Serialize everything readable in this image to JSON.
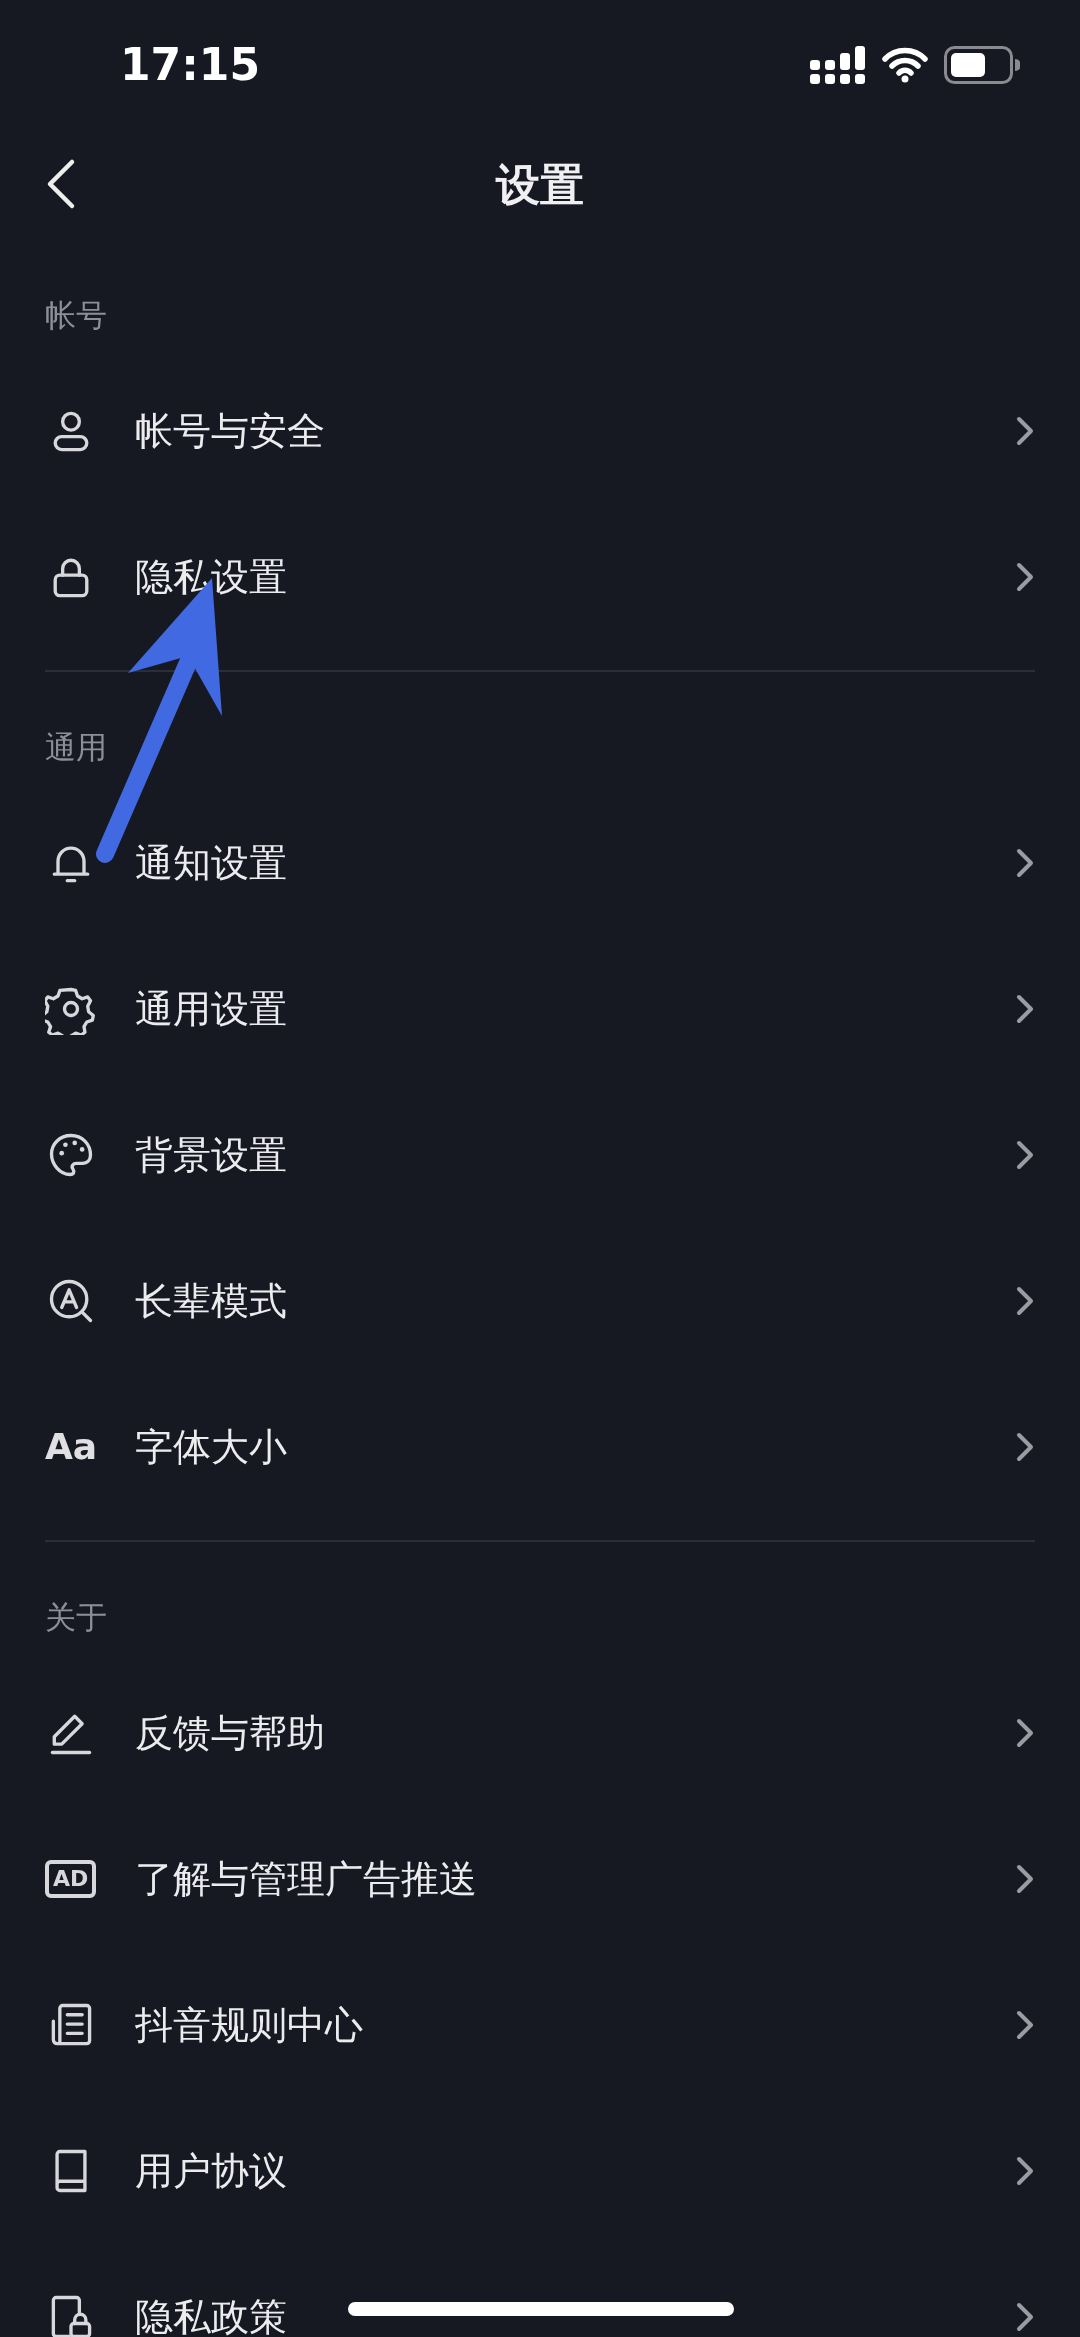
{
  "status_bar": {
    "time": "17:15"
  },
  "header": {
    "title": "设置"
  },
  "sections": [
    {
      "label": "帐号",
      "items": [
        {
          "label": "帐号与安全"
        },
        {
          "label": "隐私设置"
        }
      ]
    },
    {
      "label": "通用",
      "items": [
        {
          "label": "通知设置"
        },
        {
          "label": "通用设置"
        },
        {
          "label": "背景设置"
        },
        {
          "label": "长辈模式"
        },
        {
          "icon_text": "Aa",
          "label": "字体大小"
        }
      ]
    },
    {
      "label": "关于",
      "items": [
        {
          "label": "反馈与帮助"
        },
        {
          "icon_text": "AD",
          "label": "了解与管理广告推送"
        },
        {
          "label": "抖音规则中心"
        },
        {
          "label": "用户协议"
        },
        {
          "label": "隐私政策"
        }
      ]
    }
  ],
  "annotation": {
    "kind": "arrow",
    "color": "#4169e1"
  }
}
